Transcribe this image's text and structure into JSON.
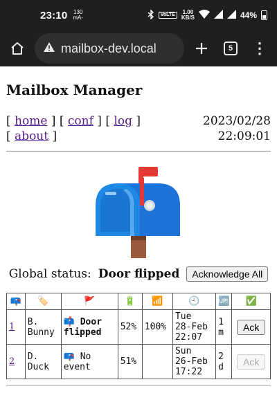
{
  "statusbar": {
    "time": "23:10",
    "data_top": "130",
    "data_bottom": "mA-",
    "net_speed_top": "1.00",
    "net_speed_bottom": "KB/S",
    "volte": "VoLTE",
    "battery": "44%"
  },
  "browser": {
    "url": "mailbox-dev.local",
    "tab_count": "5"
  },
  "page": {
    "title": "Mailbox Manager",
    "nav": {
      "home": "home",
      "conf": "conf",
      "log": "log",
      "about": "about"
    },
    "date": "2023/02/28",
    "time": "22:09:01",
    "global_status_label": "Global status:",
    "global_status_value": "Door flipped",
    "acknowledge_all_label": "Acknowledge All"
  },
  "table": {
    "headers": [
      "📪",
      "🏷️",
      "🚩",
      "🔋",
      "📶",
      "🕘",
      "🆙",
      "✅"
    ],
    "rows": [
      {
        "id": "1",
        "name": "B. Bunny",
        "event_icon": "📫",
        "event": "Door flipped",
        "battery": "52%",
        "signal": "100%",
        "date_day": "Tue",
        "date_date": "28-Feb",
        "date_time": "22:07",
        "age": "1 m",
        "ack_label": "Ack",
        "ack_enabled": true
      },
      {
        "id": "2",
        "name": "D. Duck",
        "event_icon": "📪",
        "event": "No event",
        "battery": "51%",
        "signal": "",
        "date_day": "Sun",
        "date_date": "26-Feb",
        "date_time": "17:22",
        "age": "2 d",
        "ack_label": "Ack",
        "ack_enabled": false
      }
    ]
  },
  "colors": {
    "mailbox_blue": "#1e73d8",
    "flag_red": "#e53935",
    "link": "#551a8b"
  }
}
